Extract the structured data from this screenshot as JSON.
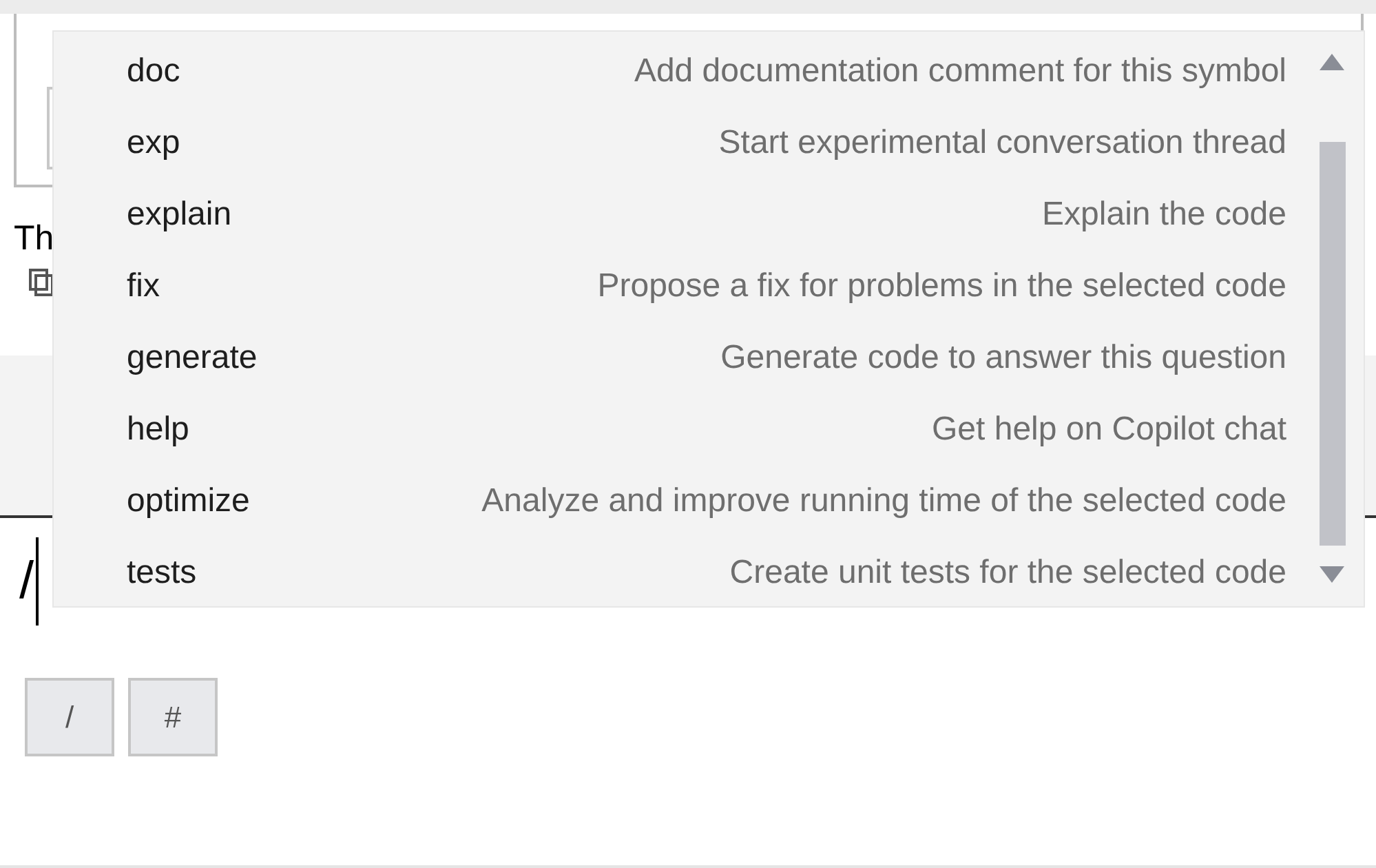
{
  "background": {
    "cut_text": "Th"
  },
  "popup": {
    "items": [
      {
        "command": "doc",
        "description": "Add documentation comment for this symbol"
      },
      {
        "command": "exp",
        "description": "Start experimental conversation thread"
      },
      {
        "command": "explain",
        "description": "Explain the code"
      },
      {
        "command": "fix",
        "description": "Propose a fix for problems in the selected code"
      },
      {
        "command": "generate",
        "description": "Generate code to answer this question"
      },
      {
        "command": "help",
        "description": "Get help on Copilot chat"
      },
      {
        "command": "optimize",
        "description": "Analyze and improve running time of the selected code"
      },
      {
        "command": "tests",
        "description": "Create unit tests for the selected code"
      }
    ]
  },
  "input": {
    "value": "/"
  },
  "buttons": [
    "/",
    "#"
  ]
}
